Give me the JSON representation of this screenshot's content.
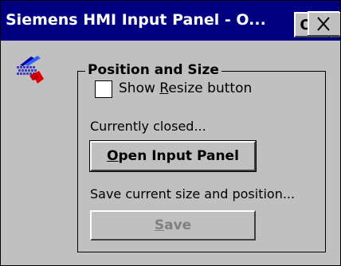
{
  "window": {
    "title": "Siemens HMI Input Panel - O...",
    "ok_label": "OK"
  },
  "group": {
    "title": "Position and Size",
    "show_resize": {
      "label_before": "Show ",
      "label_mnemonic": "R",
      "label_after": "esize button",
      "checked": false
    },
    "status_text": "Currently closed...",
    "open_button": {
      "mnemonic": "O",
      "rest": "pen Input Panel"
    },
    "save_hint": "Save current size and position...",
    "save_button": {
      "mnemonic": "S",
      "rest": "ave",
      "enabled": false
    }
  },
  "colors": {
    "titlebar": "#000080",
    "face": "#c0c0c0",
    "disabled_text": "#808080"
  },
  "icons": [
    "keyboard-pen-icon",
    "close-icon"
  ]
}
